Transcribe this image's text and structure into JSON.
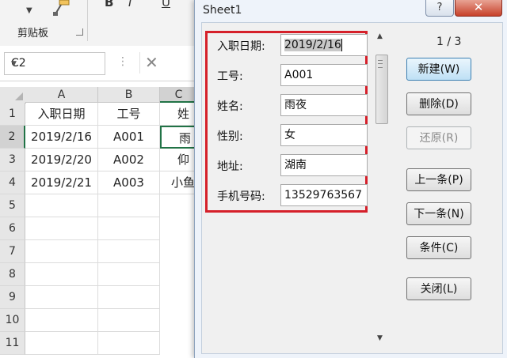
{
  "ribbon": {
    "format_buttons": [
      "B",
      "I",
      "U"
    ],
    "group_label": "剪贴板"
  },
  "formula_bar": {
    "name_box": "C2",
    "cancel_glyph": "✕"
  },
  "sheet": {
    "columns": [
      "A",
      "B",
      "C"
    ],
    "rows": [
      "1",
      "2",
      "3",
      "4",
      "5",
      "6",
      "7",
      "8",
      "9",
      "10",
      "11"
    ],
    "cells": [
      [
        "入职日期",
        "工号",
        "姓"
      ],
      [
        "2019/2/16",
        "A001",
        "雨"
      ],
      [
        "2019/2/20",
        "A002",
        "仰"
      ],
      [
        "2019/2/21",
        "A003",
        "小鱼"
      ]
    ]
  },
  "dialog": {
    "title": "Sheet1",
    "help_label": "?",
    "close_label": "✕",
    "record_counter": "1 / 3",
    "fields": [
      {
        "label": "入职日期:",
        "value": "2019/2/16"
      },
      {
        "label": "工号:",
        "value": "A001"
      },
      {
        "label": "姓名:",
        "value": "雨夜"
      },
      {
        "label": "性别:",
        "value": "女"
      },
      {
        "label": "地址:",
        "value": "湖南"
      },
      {
        "label": "手机号码:",
        "value": "13529763567"
      }
    ],
    "buttons": {
      "new": "新建(W)",
      "delete": "删除(D)",
      "restore": "还原(R)",
      "prev": "上一条(P)",
      "next": "下一条(N)",
      "criteria": "条件(C)",
      "close": "关闭(L)"
    }
  }
}
